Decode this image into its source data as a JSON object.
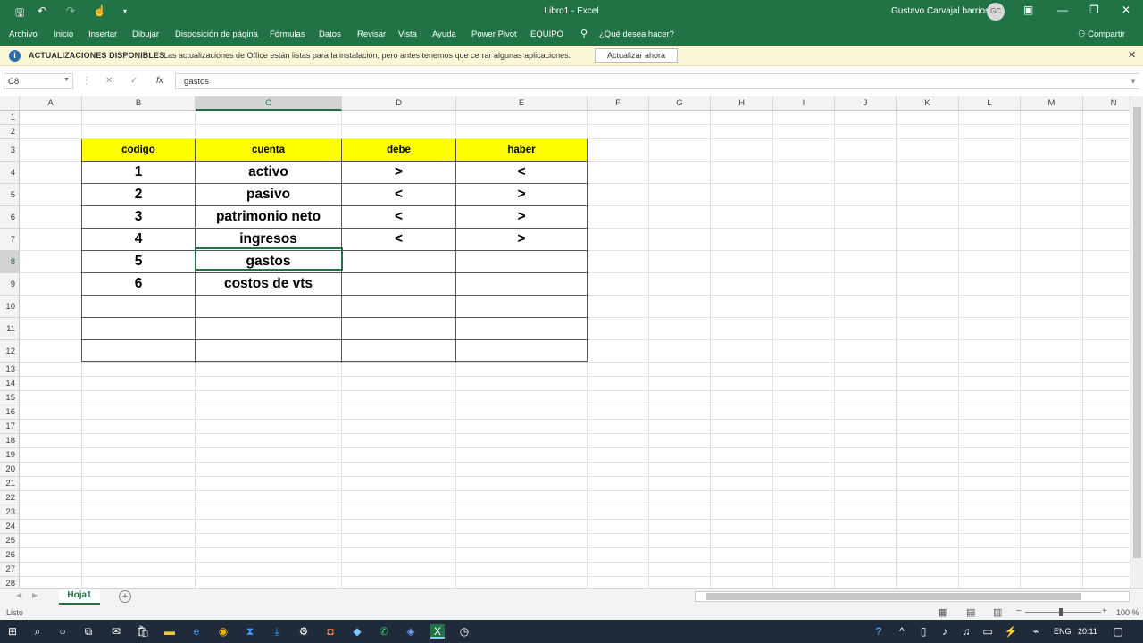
{
  "titlebar": {
    "title": "Libro1  -  Excel",
    "user": "Gustavo Carvajal barrios",
    "avatar_initials": "GC",
    "brand_color": "#217346"
  },
  "menu": [
    "Archivo",
    "Inicio",
    "Insertar",
    "Dibujar",
    "Disposición de página",
    "Fórmulas",
    "Datos",
    "Revisar",
    "Vista",
    "Ayuda",
    "Power Pivot",
    "EQUIPO",
    "¿Qué desea hacer?",
    "Compartir"
  ],
  "notice": {
    "heading": "ACTUALIZACIONES DISPONIBLES",
    "message": "Las actualizaciones de Office están listas para la instalación, pero antes tenemos que cerrar algunas aplicaciones.",
    "button": "Actualizar ahora"
  },
  "formula_bar": {
    "name_box": "C8",
    "fx": "fx",
    "content": "gastos"
  },
  "columns": [
    "A",
    "B",
    "C",
    "D",
    "E",
    "F",
    "G",
    "H",
    "I",
    "J",
    "K",
    "L",
    "M",
    "N"
  ],
  "rows": [
    "1",
    "2",
    "3",
    "4",
    "5",
    "6",
    "7",
    "8",
    "9",
    "10",
    "11",
    "12",
    "13",
    "14",
    "15",
    "16",
    "17",
    "18",
    "19",
    "20",
    "21",
    "22",
    "23",
    "24",
    "25",
    "26",
    "27",
    "28"
  ],
  "table": {
    "headers": [
      "codigo",
      "cuenta",
      "debe",
      "haber"
    ],
    "header_fill": "#ffff00",
    "rows": [
      [
        "1",
        "activo",
        ">",
        "<"
      ],
      [
        "2",
        "pasivo",
        "<",
        ">"
      ],
      [
        "3",
        "patrimonio neto",
        "<",
        ">"
      ],
      [
        "4",
        "ingresos",
        "<",
        ">"
      ],
      [
        "5",
        "gastos",
        "",
        ""
      ],
      [
        "6",
        "costos de vts",
        "",
        ""
      ],
      [
        "",
        "",
        "",
        ""
      ],
      [
        "",
        "",
        "",
        ""
      ],
      [
        "",
        "",
        "",
        ""
      ]
    ]
  },
  "sheet_tab": "Hoja1",
  "status": {
    "ready": "Listo",
    "zoom": "100 %"
  },
  "taskbar": {
    "lang": "ENG",
    "time": "20:11"
  }
}
